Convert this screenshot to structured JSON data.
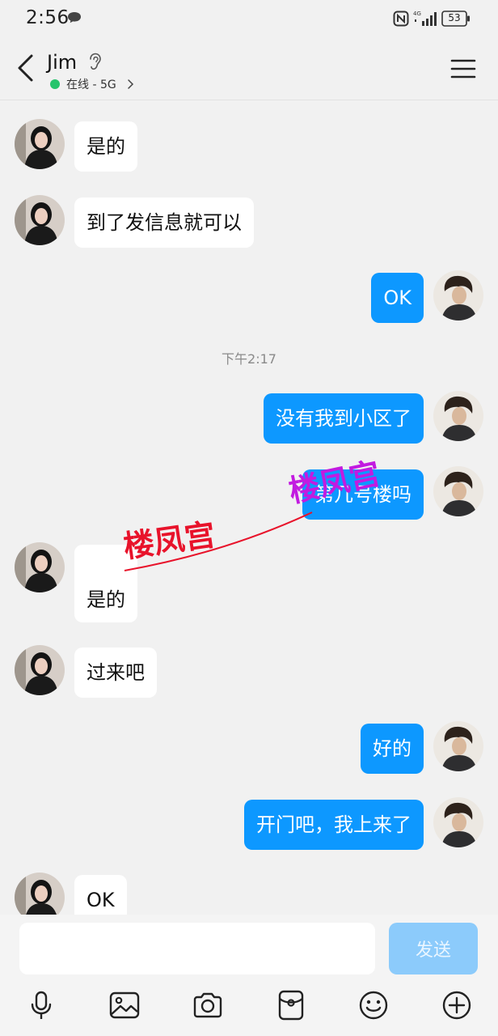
{
  "status_bar": {
    "time": "2:56",
    "network": "4G",
    "battery": "53"
  },
  "header": {
    "contact_name": "Jim",
    "online_status": "在线 - 5G"
  },
  "messages": [
    {
      "side": "in",
      "text": "是的"
    },
    {
      "side": "in",
      "text": "到了发信息就可以"
    },
    {
      "side": "out",
      "text": "OK"
    },
    {
      "side": "time",
      "text": "下午2:17"
    },
    {
      "side": "out",
      "text": "没有我到小区了"
    },
    {
      "side": "out",
      "text": "第几号楼吗"
    },
    {
      "side": "in",
      "text": "是的"
    },
    {
      "side": "in",
      "text": "过来吧"
    },
    {
      "side": "out",
      "text": "好的"
    },
    {
      "side": "out",
      "text": "开门吧，我上来了"
    },
    {
      "side": "in",
      "text": "OK"
    }
  ],
  "watermark": {
    "text_1": "楼凤宫",
    "text_2": "楼凤宫"
  },
  "input_bar": {
    "placeholder": "",
    "send_label": "发送"
  },
  "toolbar_icons": [
    "microphone-icon",
    "image-icon",
    "camera-icon",
    "red-packet-icon",
    "emoji-icon",
    "plus-icon"
  ],
  "colors": {
    "outgoing_bubble": "#0d98ff",
    "incoming_bubble": "#ffffff",
    "background": "#f1f1f1",
    "online_dot": "#25c46b",
    "send_button": "#8ccbfb",
    "watermark_red": "#e8132b",
    "watermark_purple": "#c21be0"
  }
}
